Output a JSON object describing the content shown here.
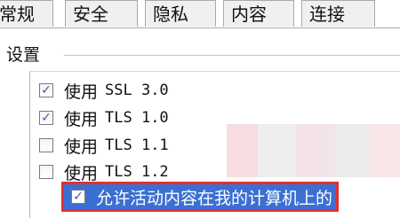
{
  "tabs": [
    "常规",
    "安全",
    "隐私",
    "内容",
    "连接"
  ],
  "section_label": "设置",
  "options": [
    {
      "prefix": "使用",
      "protocol": "SSL 3.0",
      "checked": true
    },
    {
      "prefix": "使用",
      "protocol": "TLS 1.0",
      "checked": true
    },
    {
      "prefix": "使用",
      "protocol": "TLS 1.1",
      "checked": false
    },
    {
      "prefix": "使用",
      "protocol": "TLS 1.2",
      "checked": false
    }
  ],
  "highlighted_option": {
    "label": "允许活动内容在我的计算机上的",
    "checked": true
  },
  "colors": {
    "selection": "#3b6fd2",
    "highlight_border": "#e03030"
  }
}
